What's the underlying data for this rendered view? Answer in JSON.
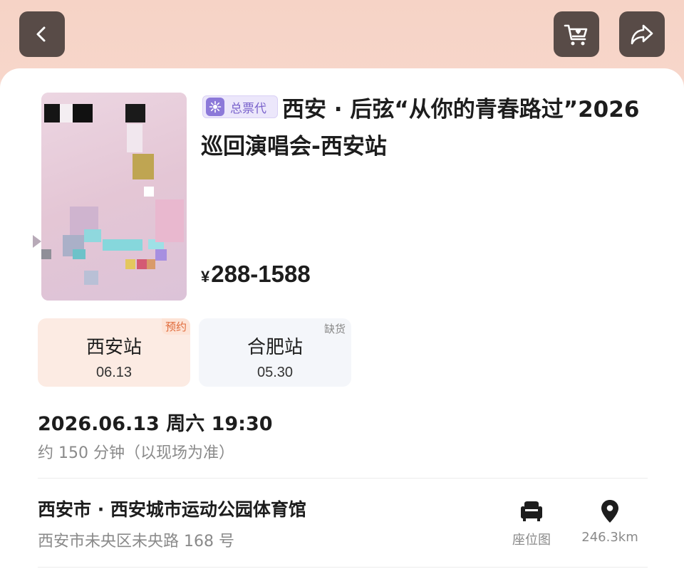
{
  "header": {
    "back_icon": "chevron-left-icon",
    "cart_icon": "cart-heart-icon",
    "share_icon": "share-arrow-icon"
  },
  "event": {
    "badge": "总票代",
    "title": "西安 · 后弦“从你的青春路过”2026巡回演唱会-西安站",
    "price_symbol": "¥",
    "price_range": "288-1588"
  },
  "sessions": [
    {
      "city": "西安站",
      "date": "06.13",
      "tag": "预约",
      "selected": true
    },
    {
      "city": "合肥站",
      "date": "05.30",
      "tag": "缺货",
      "selected": false
    }
  ],
  "schedule": {
    "datetime": "2026.06.13 周六 19:30",
    "duration": "约 150 分钟（以现场为准）"
  },
  "venue": {
    "name": "西安市 · 西安城市运动公园体育馆",
    "address": "西安市未央区未央路 168 号",
    "seat_map_label": "座位图",
    "distance": "246.3km"
  },
  "colors": {
    "header_bg": "#f6d3c6",
    "selected_session_bg": "#fcebe3",
    "selected_tag": "#e06a3a",
    "badge_purple": "#7a63cc"
  }
}
